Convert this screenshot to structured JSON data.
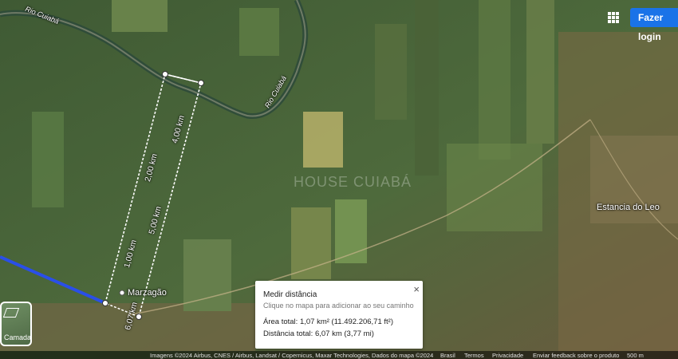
{
  "map": {
    "type": "satellite",
    "watermark": "HOUSE CUIABÁ",
    "labels": {
      "river_top": "Rio Cuiabá",
      "river_right": "Rio Cuiabá",
      "place_marzagao": "Marzagão",
      "place_estancia": "Estancia do Leo"
    },
    "segments": [
      "4,00 km",
      "2,00 km",
      "5,00 km",
      "1,00 km",
      "6,07 km"
    ]
  },
  "header": {
    "login_label": "Fazer login",
    "apps_icon": "apps-grid-icon"
  },
  "layers": {
    "label": "Camadas",
    "icon": "layers-icon"
  },
  "measure_panel": {
    "title": "Medir distância",
    "close": "×",
    "hint": "Clique no mapa para adicionar ao seu caminho",
    "area": "Área total: 1,07 km² (11.492.206,71 ft²)",
    "distance": "Distância total: 6,07 km (3,77 mi)"
  },
  "footer": {
    "imagery": "Imagens ©2024 Airbus, CNES / Airbus, Landsat / Copernicus, Maxar Technologies, Dados do mapa ©2024",
    "country": "Brasil",
    "terms": "Termos",
    "privacy": "Privacidade",
    "feedback": "Enviar feedback sobre o produto",
    "scale": "500 m"
  },
  "colors": {
    "measure_line": "#ffffff",
    "path_line": "#2a4fe8",
    "accent": "#1a73e8"
  }
}
